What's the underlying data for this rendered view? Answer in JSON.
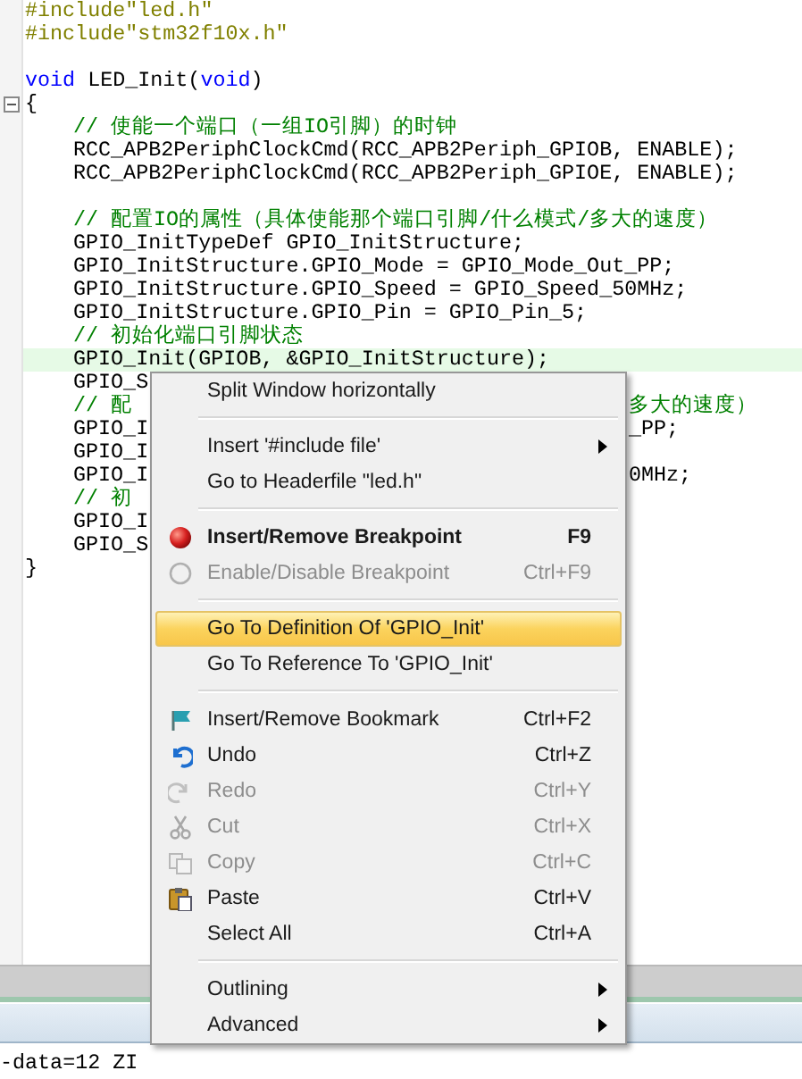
{
  "editor": {
    "lines": [
      {
        "kind": "code",
        "current": false,
        "segments": [
          {
            "kind": "preprocessor",
            "text": "#include\"led.h\""
          }
        ]
      },
      {
        "kind": "code",
        "current": false,
        "segments": [
          {
            "kind": "preprocessor",
            "text": "#include\"stm32f10x.h\""
          }
        ]
      },
      {
        "kind": "blank"
      },
      {
        "kind": "code",
        "current": false,
        "segments": [
          {
            "kind": "keyword",
            "text": "void"
          },
          {
            "kind": "plain",
            "text": " LED_Init("
          },
          {
            "kind": "keyword",
            "text": "void"
          },
          {
            "kind": "plain",
            "text": ")"
          }
        ]
      },
      {
        "kind": "code",
        "current": false,
        "expanded": true,
        "segments": [
          {
            "kind": "plain",
            "text": "{"
          }
        ],
        "children": [
          {
            "kind": "code",
            "current": false,
            "segments": [
              {
                "kind": "comment",
                "text": "// 使能一个端口（一组IO引脚）的时钟"
              }
            ]
          },
          {
            "kind": "code",
            "current": false,
            "segments": [
              {
                "kind": "plain",
                "text": "RCC_APB2PeriphClockCmd(RCC_APB2Periph_GPIOB, ENABLE);"
              }
            ]
          },
          {
            "kind": "code",
            "current": false,
            "segments": [
              {
                "kind": "plain",
                "text": "RCC_APB2PeriphClockCmd(RCC_APB2Periph_GPIOE, ENABLE);"
              }
            ]
          },
          {
            "kind": "blank"
          },
          {
            "kind": "code",
            "current": false,
            "segments": [
              {
                "kind": "comment",
                "text": "// 配置IO的属性（具体使能那个端口引脚/什么模式/多大的速度）"
              }
            ]
          },
          {
            "kind": "code",
            "current": false,
            "segments": [
              {
                "kind": "plain",
                "text": "GPIO_InitTypeDef GPIO_InitStructure;"
              }
            ]
          },
          {
            "kind": "code",
            "current": false,
            "segments": [
              {
                "kind": "plain",
                "text": "GPIO_InitStructure.GPIO_Mode = GPIO_Mode_Out_PP;"
              }
            ]
          },
          {
            "kind": "code",
            "current": false,
            "segments": [
              {
                "kind": "plain",
                "text": "GPIO_InitStructure.GPIO_Speed = GPIO_Speed_50MHz;"
              }
            ]
          },
          {
            "kind": "code",
            "current": false,
            "segments": [
              {
                "kind": "plain",
                "text": "GPIO_InitStructure.GPIO_Pin = GPIO_Pin_5;"
              }
            ]
          },
          {
            "kind": "code",
            "current": false,
            "segments": [
              {
                "kind": "comment",
                "text": "// 初始化端口引脚状态"
              }
            ]
          },
          {
            "kind": "code",
            "current": true,
            "segments": [
              {
                "kind": "plain",
                "text": "GPIO_Init(GPIOB, &GPIO_InitStructure);"
              }
            ]
          },
          {
            "kind": "code",
            "current": false,
            "segments": [
              {
                "kind": "plain",
                "text": "GPIO_S"
              }
            ]
          },
          {
            "kind": "code",
            "current": false,
            "segments": [
              {
                "kind": "comment",
                "text": "// 配"
              }
            ],
            "tail": [
              {
                "kind": "comment",
                "text": "多大的速度）"
              }
            ]
          },
          {
            "kind": "code",
            "current": false,
            "segments": [
              {
                "kind": "plain",
                "text": "GPIO_I"
              }
            ],
            "tail": [
              {
                "kind": "plain",
                "text": "_PP;"
              }
            ]
          },
          {
            "kind": "code",
            "current": false,
            "segments": [
              {
                "kind": "plain",
                "text": "GPIO_I"
              }
            ]
          },
          {
            "kind": "code",
            "current": false,
            "segments": [
              {
                "kind": "plain",
                "text": "GPIO_I"
              }
            ],
            "tail": [
              {
                "kind": "plain",
                "text": "0MHz;"
              }
            ]
          },
          {
            "kind": "code",
            "current": false,
            "segments": [
              {
                "kind": "comment",
                "text": "// 初"
              }
            ]
          },
          {
            "kind": "code",
            "current": false,
            "segments": [
              {
                "kind": "plain",
                "text": "GPIO_I"
              }
            ]
          },
          {
            "kind": "code",
            "current": false,
            "segments": [
              {
                "kind": "plain",
                "text": "GPIO_S"
              }
            ]
          }
        ]
      },
      {
        "kind": "code",
        "current": false,
        "segments": [
          {
            "kind": "plain",
            "text": "}"
          }
        ]
      }
    ]
  },
  "context_menu": {
    "items": [
      {
        "kind": "plain",
        "label": "Split Window horizontally",
        "disabled": false,
        "selected": false,
        "default": false,
        "submenu": false
      },
      {
        "kind": "separator"
      },
      {
        "kind": "plain",
        "label": "Insert '#include file'",
        "disabled": false,
        "selected": false,
        "default": false,
        "submenu": true
      },
      {
        "kind": "plain",
        "label": "Go to Headerfile \"led.h\"",
        "disabled": false,
        "selected": false,
        "default": false,
        "submenu": false
      },
      {
        "kind": "separator"
      },
      {
        "kind": "breakpoint",
        "label": "Insert/Remove Breakpoint",
        "shortcut": "F9",
        "disabled": false,
        "selected": false,
        "default": true,
        "submenu": false
      },
      {
        "kind": "breakpoint-toggle",
        "label": "Enable/Disable Breakpoint",
        "shortcut": "Ctrl+F9",
        "disabled": true,
        "selected": false,
        "default": false,
        "submenu": false
      },
      {
        "kind": "separator"
      },
      {
        "kind": "plain",
        "label": "Go To Definition Of 'GPIO_Init'",
        "disabled": false,
        "selected": true,
        "default": false,
        "submenu": false
      },
      {
        "kind": "plain",
        "label": "Go To Reference To 'GPIO_Init'",
        "disabled": false,
        "selected": false,
        "default": false,
        "submenu": false
      },
      {
        "kind": "separator"
      },
      {
        "kind": "bookmark",
        "label": "Insert/Remove Bookmark",
        "shortcut": "Ctrl+F2",
        "disabled": false,
        "selected": false,
        "default": false,
        "submenu": false
      },
      {
        "kind": "undo",
        "label": "Undo",
        "shortcut": "Ctrl+Z",
        "disabled": false,
        "selected": false,
        "default": false,
        "submenu": false
      },
      {
        "kind": "redo",
        "label": "Redo",
        "shortcut": "Ctrl+Y",
        "disabled": true,
        "selected": false,
        "default": false,
        "submenu": false
      },
      {
        "kind": "cut",
        "label": "Cut",
        "shortcut": "Ctrl+X",
        "disabled": true,
        "selected": false,
        "default": false,
        "submenu": false
      },
      {
        "kind": "copy",
        "label": "Copy",
        "shortcut": "Ctrl+C",
        "disabled": true,
        "selected": false,
        "default": false,
        "submenu": false
      },
      {
        "kind": "paste",
        "label": "Paste",
        "shortcut": "Ctrl+V",
        "disabled": false,
        "selected": false,
        "default": false,
        "submenu": false
      },
      {
        "kind": "plain",
        "label": "Select All",
        "shortcut": "Ctrl+A",
        "disabled": false,
        "selected": false,
        "default": false,
        "submenu": false
      },
      {
        "kind": "separator"
      },
      {
        "kind": "plain",
        "label": "Outlining",
        "disabled": false,
        "selected": false,
        "default": false,
        "submenu": true
      },
      {
        "kind": "plain",
        "label": "Advanced",
        "disabled": false,
        "selected": false,
        "default": false,
        "submenu": true
      }
    ]
  },
  "output": {
    "text": "-data=12 ZI"
  }
}
